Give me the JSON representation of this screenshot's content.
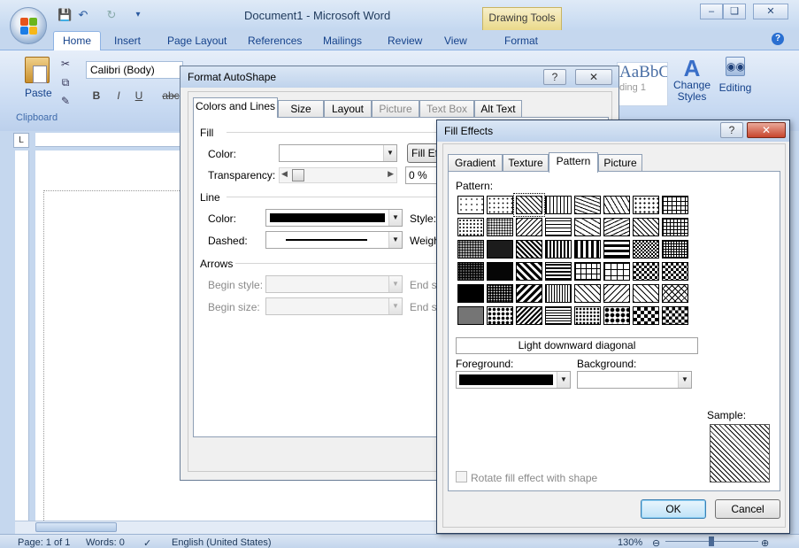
{
  "window": {
    "title": "Document1 - Microsoft Word",
    "context_tab": "Drawing Tools",
    "controls": {
      "minimize": "–",
      "restore": "❏",
      "close": "✕"
    }
  },
  "ribbon": {
    "tabs": [
      "Home",
      "Insert",
      "Page Layout",
      "References",
      "Mailings",
      "Review",
      "View",
      "Format"
    ],
    "clipboard_group": "Clipboard",
    "paste_label": "Paste",
    "font_name": "Calibri (Body)",
    "format_buttons": [
      "B",
      "I",
      "U",
      "abc"
    ],
    "styles_preview": "AaBbCc",
    "styles_heading": "ding 1",
    "change_styles": "Change Styles",
    "editing": "Editing"
  },
  "statusbar": {
    "page": "Page: 1 of 1",
    "words": "Words: 0",
    "language": "English (United States)",
    "zoom": "130%"
  },
  "format_autoshape": {
    "title": "Format AutoShape",
    "tabs": [
      {
        "label": "Colors and Lines",
        "active": true,
        "enabled": true
      },
      {
        "label": "Size",
        "active": false,
        "enabled": true
      },
      {
        "label": "Layout",
        "active": false,
        "enabled": true
      },
      {
        "label": "Picture",
        "active": false,
        "enabled": false
      },
      {
        "label": "Text Box",
        "active": false,
        "enabled": false
      },
      {
        "label": "Alt Text",
        "active": false,
        "enabled": true
      }
    ],
    "fill": {
      "section": "Fill",
      "color_label": "Color:",
      "fill_effects_button": "Fill Eff",
      "transparency_label": "Transparency:",
      "transparency_value": "0 %",
      "transparency_level": 0
    },
    "line": {
      "section": "Line",
      "color_label": "Color:",
      "color_value": "#000000",
      "dashed_label": "Dashed:",
      "style_label": "Style:",
      "weight_label": "Weigh"
    },
    "arrows": {
      "section": "Arrows",
      "begin_style_label": "Begin style:",
      "begin_size_label": "Begin size:",
      "end_style_label": "End st",
      "end_size_label": "End si"
    }
  },
  "fill_effects": {
    "title": "Fill Effects",
    "help": "?",
    "close": "✕",
    "tabs": [
      {
        "label": "Gradient",
        "active": false
      },
      {
        "label": "Texture",
        "active": false
      },
      {
        "label": "Pattern",
        "active": true
      },
      {
        "label": "Picture",
        "active": false
      }
    ],
    "pattern_label": "Pattern:",
    "selected_pattern": "Light downward diagonal",
    "foreground_label": "Foreground:",
    "foreground_color": "#000000",
    "background_label": "Background:",
    "background_color": "#ffffff",
    "sample_label": "Sample:",
    "rotate_label": "Rotate fill effect with shape",
    "rotate_checked": false,
    "ok": "OK",
    "cancel": "Cancel",
    "patterns": [
      [
        "dots5",
        "dots10",
        "ldiag-sel",
        "vert",
        "wave",
        "zigzag",
        "dots-d",
        "grid-l"
      ],
      [
        "dots20",
        "dots25",
        "rdiag",
        "hor",
        "shingle",
        "dwave",
        "ddiag",
        "grid-d"
      ],
      [
        "dots30",
        "dots50",
        "dark-ldiag",
        "dark-vert",
        "dash-h",
        "dash-v",
        "trellis",
        "grid-sm"
      ],
      [
        "dots60",
        "dots70",
        "wide-ldiag",
        "dark-hor",
        "brick-h",
        "brick-v",
        "plaid",
        "checker-s"
      ],
      [
        "dots75",
        "dots80",
        "wide-rdiag",
        "narrow-vert",
        "dash-dd",
        "dash-ud",
        "diamond-o",
        "lattice"
      ],
      [
        "dots90",
        "dots-big",
        "dark-rdiag",
        "narrow-hor",
        "confetti",
        "sphere",
        "checker-l",
        "diamond-s"
      ]
    ]
  }
}
